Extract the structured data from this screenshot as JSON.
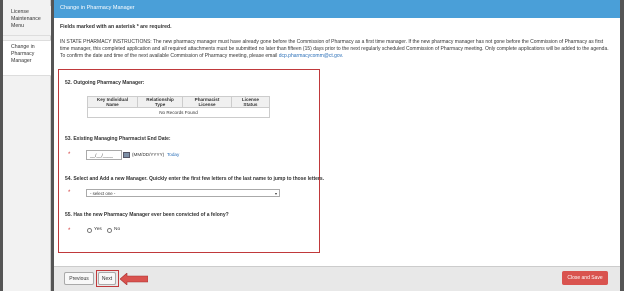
{
  "sidebar": {
    "items": [
      {
        "label": "License Maintenance Menu"
      },
      {
        "label": "Change in Pharmacy Manager"
      }
    ]
  },
  "header": {
    "title": "Change in Pharmacy Manager"
  },
  "required_note": "Fields marked with an asterisk * are required.",
  "instructions": {
    "text": "IN STATE PHARMACY INSTRUCTIONS: The new pharmacy manager must have already gone before the Commission of Pharmacy as a first time manager. If the new pharmacy manager has not gone before the Commission of Pharmacy as first time manager, this completed application and all required attachments must be submitted no later than fifteen (15) days prior to the next regularly scheduled Commission of Pharmacy meeting. Only complete applications will be added to the agenda. To confirm the date and time of the next available Commission of Pharmacy meeting, please email",
    "email": "dcp.pharmacycomm@ct.gov."
  },
  "questions": {
    "q52": "52. Outgoing Pharmacy Manager:",
    "q53": "53. Existing Managing Pharmacist End Date:",
    "q54": "54. Select and Add a new Manager. Quickly enter the first few letters of the last name to jump to those letters.",
    "q55": "55. Has the new Pharmacy Manager ever been convicted of a felony?"
  },
  "table": {
    "headers": [
      "Key Individual Name",
      "Relationship Type",
      "Pharmacist License",
      "License Status"
    ],
    "empty_text": "No Records Found"
  },
  "date_field": {
    "value": "__/__/____",
    "format": "(MM/DD/YYYY)",
    "today_link": "Today"
  },
  "manager_select": {
    "selected": "- select one -"
  },
  "felony_radio": {
    "yes": "Yes",
    "no": "No"
  },
  "asterisk": "*",
  "footer": {
    "previous": "Previous",
    "next": "Next",
    "close_save": "Close and Save"
  },
  "colors": {
    "header": "#4a9fd8",
    "highlight": "#c0393b",
    "close_button": "#d9534f",
    "link": "#2a6fb8"
  }
}
